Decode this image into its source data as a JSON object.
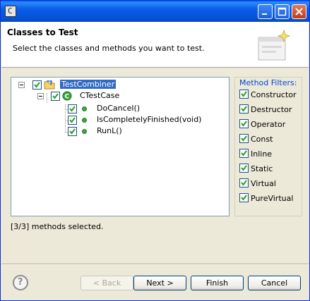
{
  "window": {
    "title": "",
    "app_icon_letter": "C",
    "controls": [
      "minimize-icon",
      "maximize-icon",
      "close-icon"
    ]
  },
  "header": {
    "title": "Classes to Test",
    "description": "Select the classes and methods you want to test."
  },
  "tree": {
    "root": {
      "label": "TestCombiner",
      "checked": true,
      "expanded": true,
      "icon": "project-folder-icon"
    },
    "class": {
      "label": "CTestCase",
      "checked": true,
      "expanded": true,
      "icon": "class-icon"
    },
    "methods": [
      {
        "label": "DoCancel()",
        "checked": true,
        "icon": "method-icon"
      },
      {
        "label": "IsCompletelyFinished(void)",
        "checked": true,
        "icon": "method-icon"
      },
      {
        "label": "RunL()",
        "checked": true,
        "icon": "method-icon"
      }
    ]
  },
  "filters": {
    "title": "Method Filters:",
    "items": [
      {
        "label": "Constructor",
        "checked": true
      },
      {
        "label": "Destructor",
        "checked": true
      },
      {
        "label": "Operator",
        "checked": true
      },
      {
        "label": "Const",
        "checked": true
      },
      {
        "label": "Inline",
        "checked": true
      },
      {
        "label": "Static",
        "checked": true
      },
      {
        "label": "Virtual",
        "checked": true
      },
      {
        "label": "PureVirtual",
        "checked": true
      }
    ]
  },
  "status": "[3/3] methods selected.",
  "buttons": {
    "back": "< Back",
    "next": "Next >",
    "finish": "Finish",
    "cancel": "Cancel"
  },
  "colors": {
    "selection": "#316ac5",
    "filter_title": "#0046d5",
    "checkmark": "#21a121"
  }
}
